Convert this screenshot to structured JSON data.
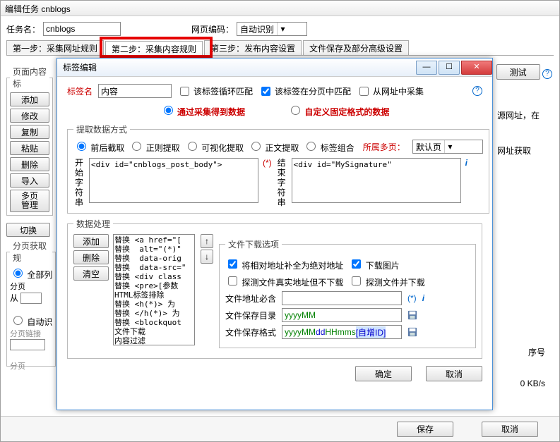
{
  "main": {
    "title": "编辑任务 cnblogs",
    "task_name_lbl": "任务名：",
    "task_name": "cnblogs",
    "encoding_lbl": "网页编码：",
    "encoding": "自动识别",
    "tabs": [
      "第一步：采集网址规则",
      "第二步：采集内容规则",
      "第三步：发布内容设置",
      "文件保存及部分高级设置"
    ],
    "panel1": "页面内容标",
    "side_buttons": [
      "添加",
      "修改",
      "复制",
      "粘贴",
      "删除",
      "导入"
    ],
    "multi_btn": "多页",
    "multi_btn2": "管理",
    "switch_btn": "切换",
    "panel2": "分页获取规",
    "r_all": "全部列",
    "r_auto": "自动识",
    "paging_lbl": "分页",
    "from_lbl": "从",
    "paging_link_lbl": "分页链接",
    "paging_col_lbl": "分页",
    "test_btn": "测试",
    "right_text1": "源网址，在",
    "right_text2": "网址获取",
    "seq_col": "序号",
    "speed": "0 KB/s",
    "save": "保存",
    "cancel": "取消"
  },
  "modal": {
    "title": "标签编辑",
    "label_name_lbl": "标签名",
    "label_name": "内容",
    "chk_loop": "该标签循环匹配",
    "chk_page": "该标签在分页中匹配",
    "chk_url": "从网址中采集",
    "r_collect": "通过采集得到数据",
    "r_custom": "自定义固定格式的数据",
    "extract_legend": "提取数据方式",
    "extract_radios": [
      "前后截取",
      "正则提取",
      "可视化提取",
      "正文提取",
      "标签组合"
    ],
    "belong_lbl": "所属多页：",
    "belong_val": "默认页",
    "start_cap": "开始字符串",
    "start_val": "<div id=\"cnblogs_post_body\">",
    "end_cap": "结束字符串",
    "end_val": "<div id=\"MySignature\"",
    "dp_legend": "数据处理",
    "dp_btns": [
      "添加",
      "删除",
      "清空"
    ],
    "dp_list": "替换 <a href=\"[\n替换  alt=\"(*)\"\n替换  data-orig\n替换  data-src=\"\n替换 <div class\n替换 <pre>[参数\nHTML标签排除\n替换 <h(*)> 为\n替换 </h(*)> 为\n替换 <blockquot\n文件下载\n内容过滤",
    "arrows": [
      "↑",
      "↓"
    ],
    "dl_legend": "文件下载选项",
    "chk_abs": "将相对地址补全为绝对地址",
    "chk_img": "下载图片",
    "chk_probe": "探测文件真实地址但不下载",
    "chk_probe_dl": "探测文件并下载",
    "f_must": "文件地址必含",
    "f_must_val": "",
    "star_i": "(*)",
    "f_dir": "文件保存目录",
    "f_fmt": "文件保存格式",
    "y": "yyyy",
    "mm": "MM",
    "dd": "dd",
    "hh": "HH",
    "ms": "mms",
    "id": "[自增ID]",
    "ok": "确定",
    "cancel": "取消"
  }
}
